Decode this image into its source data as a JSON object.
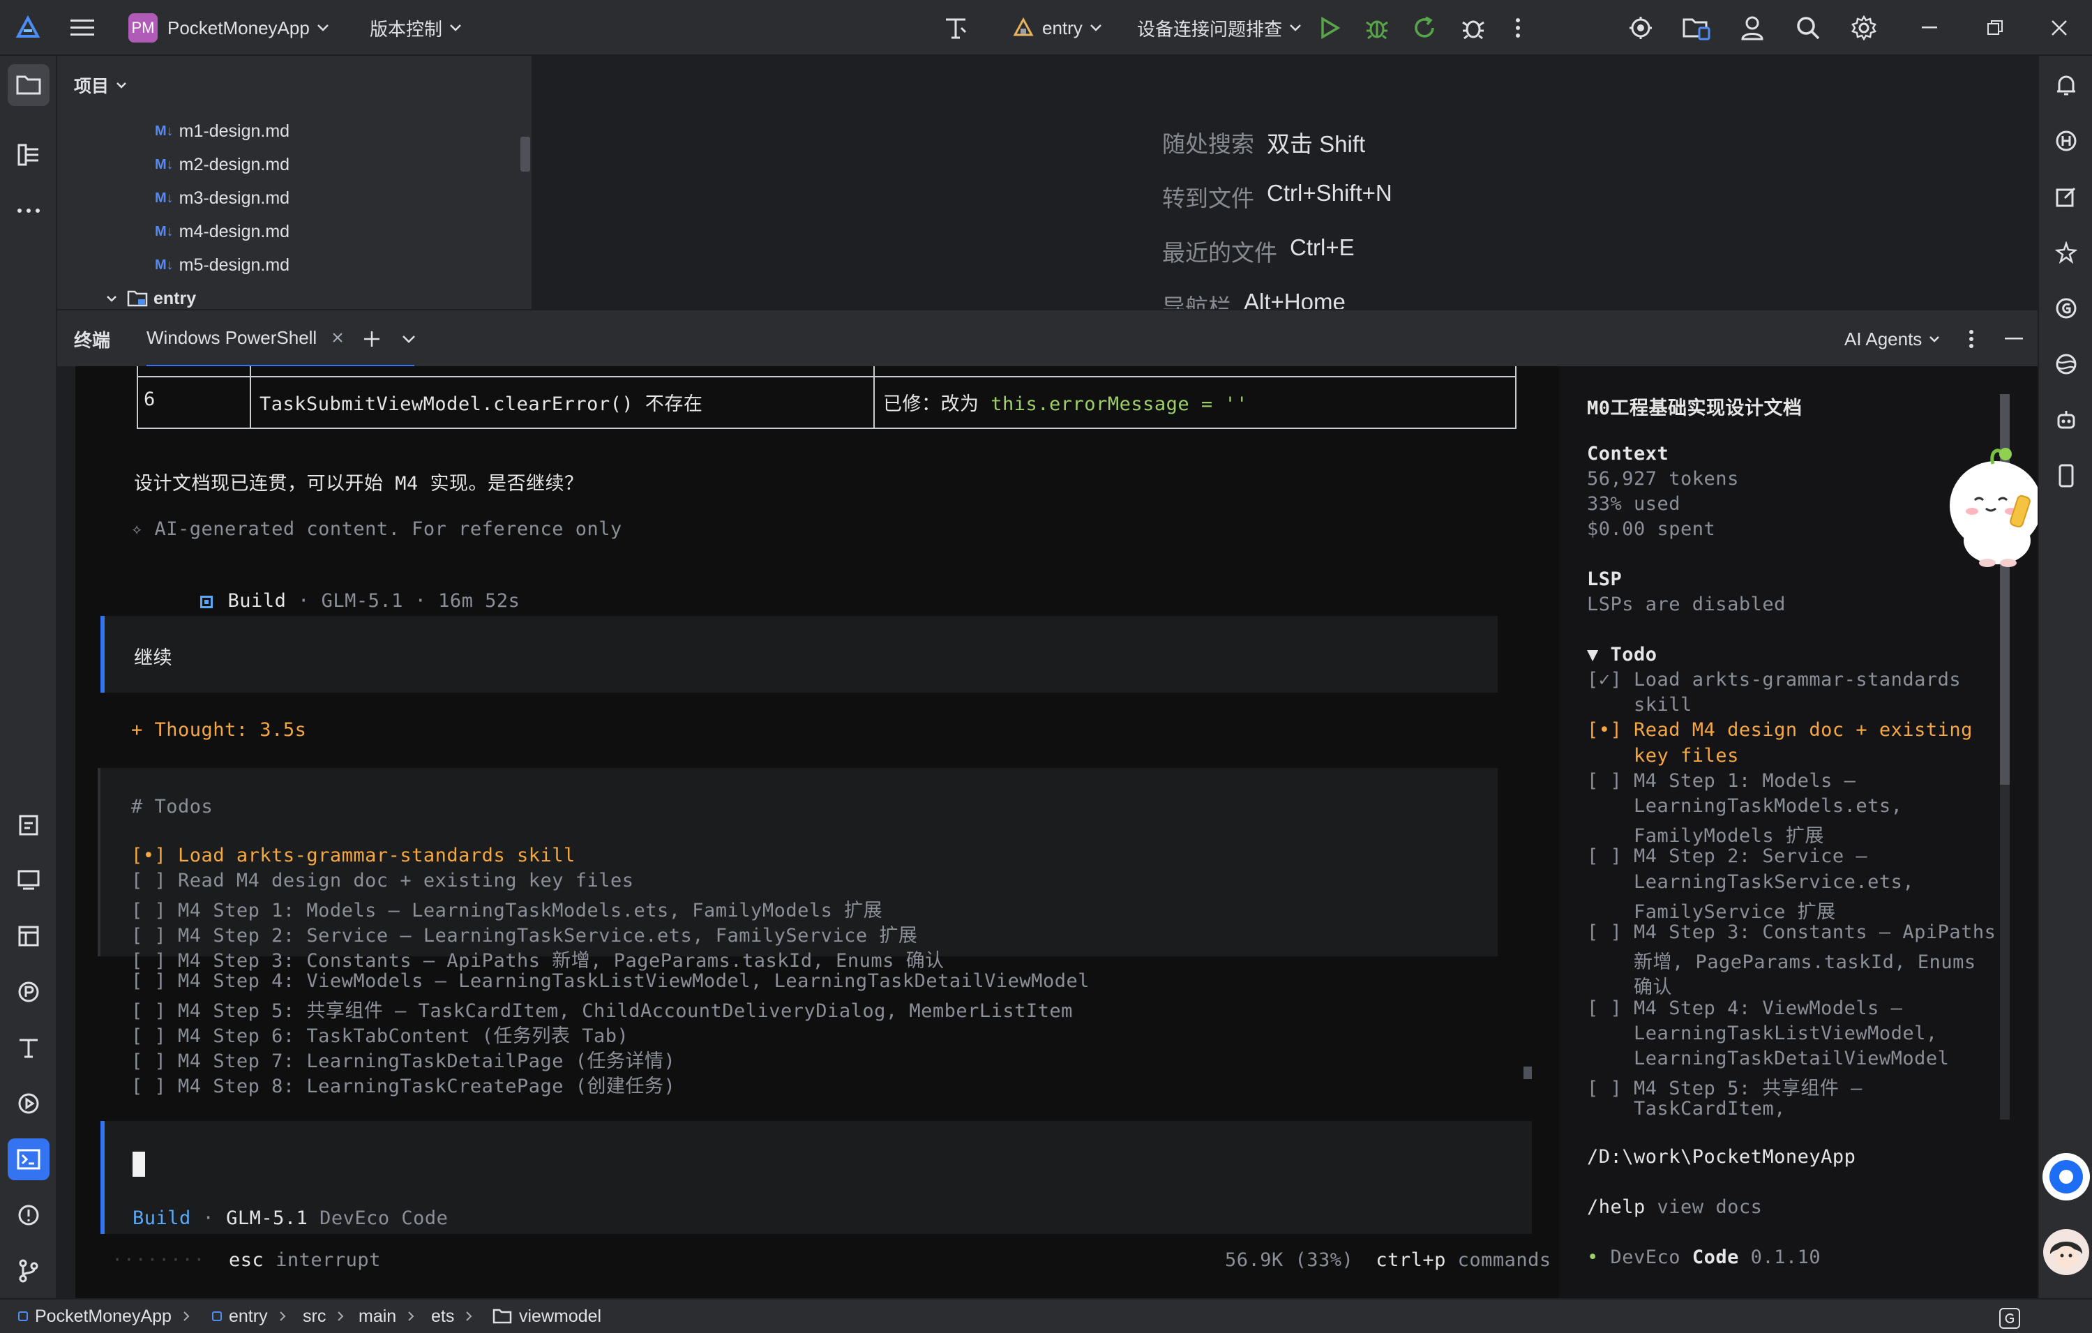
{
  "titlebar": {
    "project_badge": "PM",
    "project_name": "PocketMoneyApp",
    "vcs": "版本控制",
    "run_config": "entry",
    "device": "设备连接问题排查"
  },
  "project_panel": {
    "title": "项目",
    "files": [
      "m1-design.md",
      "m2-design.md",
      "m3-design.md",
      "m4-design.md",
      "m5-design.md"
    ],
    "md_badge": "M↓",
    "folder": "entry"
  },
  "editor_hints": [
    {
      "label": "随处搜索",
      "key": "双击 Shift"
    },
    {
      "label": "转到文件",
      "key": "Ctrl+Shift+N"
    },
    {
      "label": "最近的文件",
      "key": "Ctrl+E"
    },
    {
      "label": "导航栏",
      "key": "Alt+Home"
    }
  ],
  "terminal": {
    "title": "终端",
    "tab": "Windows PowerShell",
    "ai_agents": "AI Agents"
  },
  "chat": {
    "table_row": {
      "num": "6",
      "issue": "TaskSubmitViewModel.clearError() 不存在",
      "fix_prefix": "已修：改为 ",
      "fix_code": "this.errorMessage = ''"
    },
    "message": "设计文档现已连贯，可以开始 M4 实现。是否继续？",
    "disclaimer": "✧ AI-generated content. For reference only",
    "build_label": "Build",
    "build_meta": " · GLM-5.1 · 16m 52s",
    "user_input": "继续",
    "thought": "+ Thought: 3.5s",
    "todos_header": "# Todos",
    "todos": [
      {
        "status": "[•]",
        "text": "Load arkts-grammar-standards skill",
        "active": true
      },
      {
        "status": "[ ]",
        "text": "Read M4 design doc + existing key files",
        "active": false
      },
      {
        "status": "[ ]",
        "text": "M4 Step 1: Models — LearningTaskModels.ets, FamilyModels 扩展",
        "active": false
      },
      {
        "status": "[ ]",
        "text": "M4 Step 2: Service — LearningTaskService.ets, FamilyService 扩展",
        "active": false
      },
      {
        "status": "[ ]",
        "text": "M4 Step 3: Constants — ApiPaths 新增, PageParams.taskId, Enums 确认",
        "active": false
      },
      {
        "status": "[ ]",
        "text": "M4 Step 4: ViewModels — LearningTaskListViewModel, LearningTaskDetailViewModel",
        "active": false
      },
      {
        "status": "[ ]",
        "text": "M4 Step 5: 共享组件 — TaskCardItem, ChildAccountDeliveryDialog, MemberListItem",
        "active": false
      },
      {
        "status": "[ ]",
        "text": "M4 Step 6: TaskTabContent (任务列表 Tab)",
        "active": false
      },
      {
        "status": "[ ]",
        "text": "M4 Step 7: LearningTaskDetailPage (任务详情)",
        "active": false
      },
      {
        "status": "[ ]",
        "text": "M4 Step 8: LearningTaskCreatePage (创建任务)",
        "active": false
      }
    ],
    "prompt_mode": "Build",
    "prompt_model": "GLM-5.1",
    "prompt_app": "DevEco Code",
    "footer_dots": "········",
    "footer_esc": "esc",
    "footer_interrupt": " interrupt",
    "footer_usage": "56.9K (33%)",
    "footer_ctrl": "ctrl+p",
    "footer_commands": " commands"
  },
  "sidebar": {
    "title": "M0工程基础实现设计文档",
    "context_label": "Context",
    "tokens": "56,927 tokens",
    "used": "33% used",
    "spent": "$0.00 spent",
    "lsp_label": "LSP",
    "lsp_value": "LSPs are disabled",
    "todo_label": "▼ Todo",
    "todo_lines": [
      {
        "text": "[✓] Load arkts-grammar-standards",
        "state": "done"
      },
      {
        "text": "    skill",
        "state": "done"
      },
      {
        "text": "[•] Read M4 design doc + existing",
        "state": "active"
      },
      {
        "text": "    key files",
        "state": "active"
      },
      {
        "text": "[ ] M4 Step 1: Models —",
        "state": "pending"
      },
      {
        "text": "    LearningTaskModels.ets,",
        "state": "pending"
      },
      {
        "text": "    FamilyModels 扩展",
        "state": "pending"
      },
      {
        "text": "[ ] M4 Step 2: Service —",
        "state": "pending"
      },
      {
        "text": "    LearningTaskService.ets,",
        "state": "pending"
      },
      {
        "text": "    FamilyService 扩展",
        "state": "pending"
      },
      {
        "text": "[ ] M4 Step 3: Constants — ApiPaths",
        "state": "pending"
      },
      {
        "text": "    新增, PageParams.taskId, Enums",
        "state": "pending"
      },
      {
        "text": "    确认",
        "state": "pending"
      },
      {
        "text": "[ ] M4 Step 4: ViewModels —",
        "state": "pending"
      },
      {
        "text": "    LearningTaskListViewModel,",
        "state": "pending"
      },
      {
        "text": "    LearningTaskDetailViewModel",
        "state": "pending"
      },
      {
        "text": "[ ] M4 Step 5: 共享组件 —",
        "state": "pending"
      },
      {
        "text": "    TaskCardItem,",
        "state": "pending"
      }
    ],
    "path": "/D:\\work\\PocketMoneyApp",
    "help_cmd": "/help",
    "help_text": " view docs",
    "brand_dot": "•",
    "brand_deveco": " DevEco ",
    "brand_code": "Code",
    "brand_version": " 0.1.10"
  },
  "statusbar": {
    "crumbs": [
      "PocketMoneyApp",
      "entry",
      "src",
      "main",
      "ets",
      "viewmodel"
    ]
  },
  "colors": {
    "accent": "#3574f0",
    "orange": "#f5a742",
    "green": "#9ece6a",
    "run_green": "#57a64a"
  }
}
